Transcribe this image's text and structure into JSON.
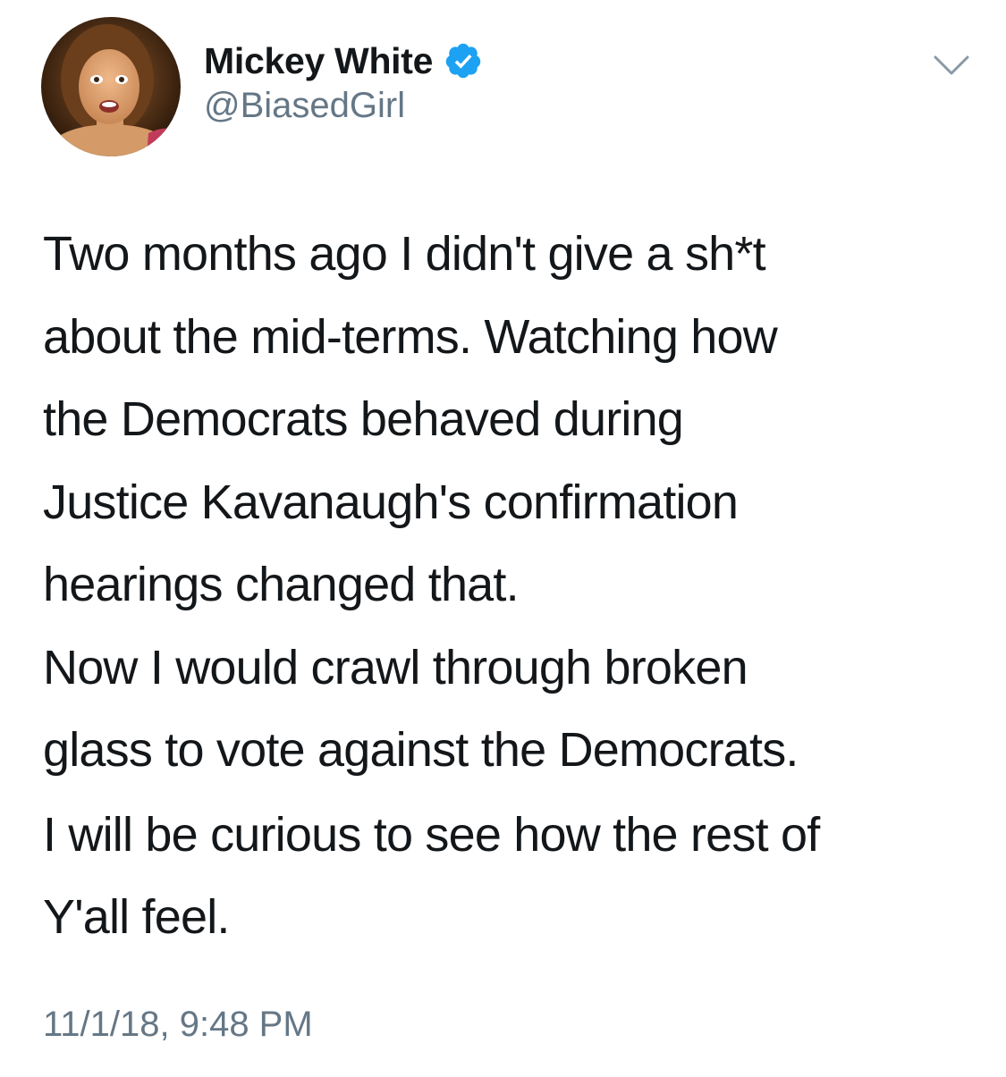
{
  "author": {
    "display_name": "Mickey White",
    "handle": "@BiasedGirl",
    "verified": true,
    "verified_color": "#1da1f2",
    "avatar_icon": "profile-photo"
  },
  "menu": {
    "icon": "chevron-down-icon"
  },
  "tweet": {
    "paragraph1_lines": [
      "Two months ago I didn't give a sh*t",
      "about the mid-terms. Watching how",
      "the Democrats behaved during",
      "Justice Kavanaugh's confirmation",
      "hearings changed that.",
      "Now I would crawl through broken",
      "glass to vote against the Democrats."
    ],
    "paragraph2_lines": [
      "I will be curious to see how the rest of",
      "Y'all feel."
    ],
    "timestamp": "11/1/18, 9:48 PM"
  },
  "colors": {
    "text_primary": "#14171a",
    "text_secondary": "#657786",
    "background": "#ffffff"
  }
}
